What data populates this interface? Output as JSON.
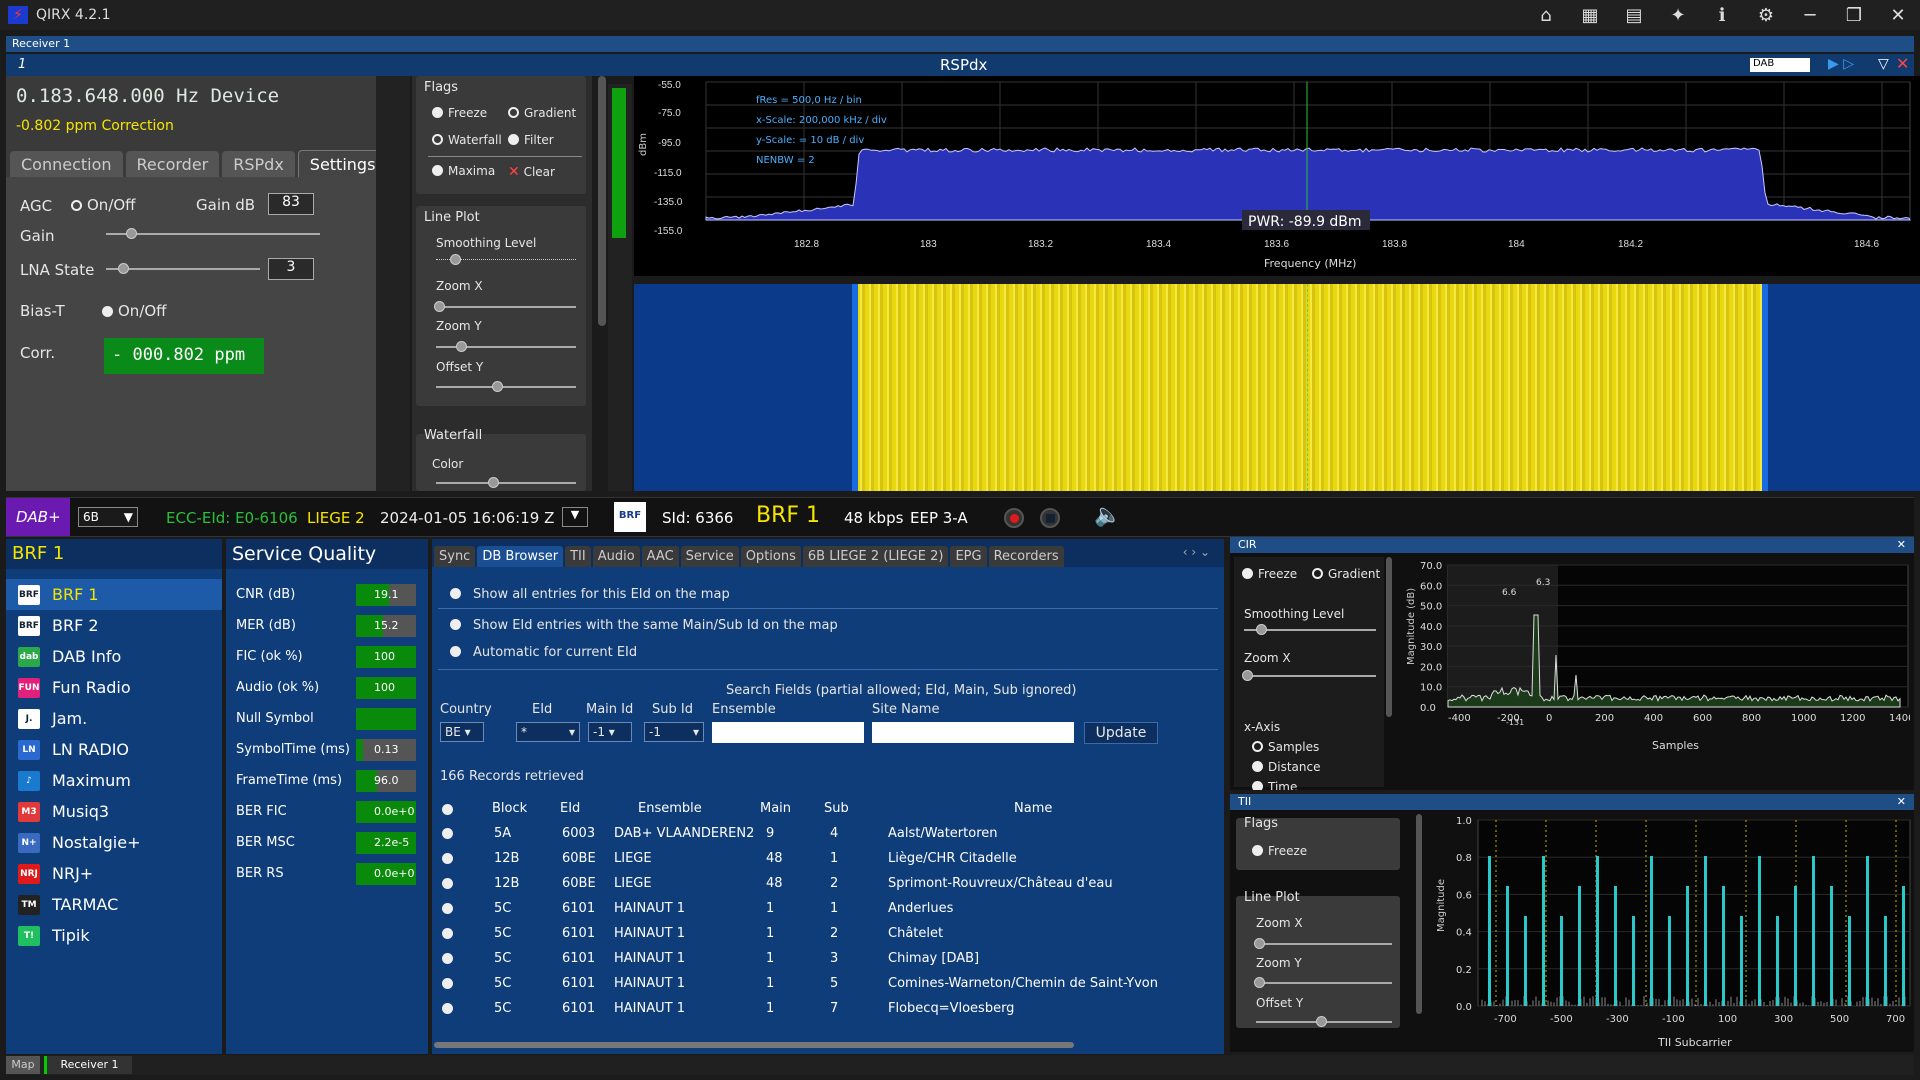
{
  "app": {
    "title": "QIRX 4.2.1",
    "icons": [
      "home-icon",
      "table-icon",
      "map-icon",
      "satellite-icon",
      "info-icon",
      "gear-icon"
    ]
  },
  "receiver": {
    "label": "Receiver 1",
    "number": "1",
    "device": "RSPdx",
    "mode": "DAB"
  },
  "left": {
    "freq": "0.183.648.000 Hz Device",
    "ppm": "-0.802 ppm Correction",
    "tabs": [
      "Connection",
      "Recorder",
      "RSPdx",
      "Settings"
    ],
    "agc": "AGC",
    "agc_toggle": "On/Off",
    "gain_db": "Gain dB",
    "gain_val": "83",
    "gain": "Gain",
    "lna": "LNA State",
    "lna_val": "3",
    "biast": "Bias-T",
    "biast_toggle": "On/Off",
    "corr": "Corr.",
    "corr_val": "- 000.802 ppm"
  },
  "flags": {
    "title": "Flags",
    "freeze": "Freeze",
    "gradient": "Gradient",
    "waterfall": "Waterfall",
    "filter": "Filter",
    "maxima": "Maxima",
    "clear": "Clear",
    "lineplot": "Line Plot",
    "smoothing": "Smoothing Level",
    "zoomx": "Zoom X",
    "zoomy": "Zoom Y",
    "offsety": "Offset Y",
    "wf_title": "Waterfall",
    "color": "Color"
  },
  "spectrum": {
    "ylabel": "dBm",
    "yticks": [
      "-55.0",
      "-75.0",
      "-95.0",
      "-115.0",
      "-135.0",
      "-155.0"
    ],
    "xticks": [
      "182.8",
      "183",
      "183.2",
      "183.4",
      "183.6",
      "183.8",
      "184",
      "184.2",
      "184.6"
    ],
    "xlabel": "Frequency (MHz)",
    "info": [
      "fRes = 500,0 Hz / bin",
      "x-Scale: 200,000 kHz / div",
      "y-Scale: = 10 dB / div",
      "NENBW = 2"
    ],
    "pwr": "PWR: -89.9 dBm"
  },
  "status": {
    "dab": "DAB+",
    "channel": "6B",
    "ecc": "ECC-EId: E0-6106",
    "region": "LIEGE 2",
    "datetime": "2024-01-05  16:06:19 Z",
    "sid": "SId: 6366",
    "service": "BRF 1",
    "rate": "48 kbps",
    "eep": "EEP 3-A"
  },
  "services": {
    "title": "BRF 1",
    "items": [
      {
        "name": "BRF 1",
        "logo": "BRF",
        "color": "#ffffff"
      },
      {
        "name": "BRF 2",
        "logo": "BRF",
        "color": "#ffffff"
      },
      {
        "name": "DAB Info",
        "logo": "dab",
        "color": "#2aa84a"
      },
      {
        "name": "Fun Radio",
        "logo": "FUN",
        "color": "#e0207a"
      },
      {
        "name": "Jam.",
        "logo": "J.",
        "color": "#ffffff"
      },
      {
        "name": "LN RADIO",
        "logo": "LN",
        "color": "#2a6ad0"
      },
      {
        "name": "Maximum",
        "logo": "♪",
        "color": "#1a7ad0"
      },
      {
        "name": "Musiq3",
        "logo": "M3",
        "color": "#e03a3a"
      },
      {
        "name": "Nostalgie+",
        "logo": "N+",
        "color": "#3a6ac0"
      },
      {
        "name": "NRJ+",
        "logo": "NRJ",
        "color": "#e01a1a"
      },
      {
        "name": "TARMAC",
        "logo": "TM",
        "color": "#222"
      },
      {
        "name": "Tipik",
        "logo": "T!",
        "color": "#20c060"
      }
    ]
  },
  "quality": {
    "title": "Service Quality",
    "rows": [
      {
        "label": "CNR (dB)",
        "value": "19.1",
        "fill": 0.55
      },
      {
        "label": "MER (dB)",
        "value": "15.2",
        "fill": 0.45
      },
      {
        "label": "FIC (ok %)",
        "value": "100",
        "fill": 1.0
      },
      {
        "label": "Audio (ok %)",
        "value": "100",
        "fill": 1.0
      },
      {
        "label": "Null Symbol",
        "value": "",
        "fill": 1.0
      },
      {
        "label": "SymbolTime (ms)",
        "value": "0.13",
        "fill": 0.12
      },
      {
        "label": "FrameTime (ms)",
        "value": "96.0",
        "fill": 0.35
      },
      {
        "label": "BER FIC",
        "value": "0.0e+0",
        "fill": 1.0
      },
      {
        "label": "BER MSC",
        "value": "2.2e-5",
        "fill": 1.0
      },
      {
        "label": "BER RS",
        "value": "0.0e+0",
        "fill": 1.0
      }
    ]
  },
  "db": {
    "tabs": [
      "Sync",
      "DB Browser",
      "TII",
      "Audio",
      "AAC",
      "Service",
      "Options",
      "6B LIEGE 2 (LIEGE 2)",
      "EPG",
      "Recorders"
    ],
    "opt1": "Show all entries for this EId on the map",
    "opt2": "Show EId entries with the same Main/Sub Id on the map",
    "opt3": "Automatic for current EId",
    "search": "Search Fields  (partial allowed; EId, Main, Sub ignored)",
    "fields": {
      "country": "Country",
      "eid": "EId",
      "main": "Main Id",
      "sub": "Sub Id",
      "ensemble": "Ensemble",
      "site": "Site Name"
    },
    "vals": {
      "country": "BE",
      "eid": "*",
      "main": "-1",
      "sub": "-1"
    },
    "update": "Update",
    "records": "166 Records retrieved",
    "cols": [
      "Block",
      "EId",
      "Ensemble",
      "Main",
      "Sub",
      "Name"
    ],
    "rows": [
      [
        "5A",
        "6003",
        "DAB+ VLAANDEREN2",
        "9",
        "4",
        "Aalst/Watertoren"
      ],
      [
        "12B",
        "60BE",
        "LIEGE",
        "48",
        "1",
        "Liège/CHR Citadelle"
      ],
      [
        "12B",
        "60BE",
        "LIEGE",
        "48",
        "2",
        "Sprimont-Rouvreux/Château d'eau"
      ],
      [
        "5C",
        "6101",
        "HAINAUT 1",
        "1",
        "1",
        "Anderlues"
      ],
      [
        "5C",
        "6101",
        "HAINAUT 1",
        "1",
        "2",
        "Châtelet"
      ],
      [
        "5C",
        "6101",
        "HAINAUT 1",
        "1",
        "3",
        "Chimay [DAB]"
      ],
      [
        "5C",
        "6101",
        "HAINAUT 1",
        "1",
        "5",
        "Comines-Warneton/Chemin de Saint-Yvon"
      ],
      [
        "5C",
        "6101",
        "HAINAUT 1",
        "1",
        "7",
        "Flobecq=Vloesberg"
      ]
    ]
  },
  "cir": {
    "title": "CIR",
    "freeze": "Freeze",
    "gradient": "Gradient",
    "smoothing": "Smoothing Level",
    "zoomx": "Zoom X",
    "xaxis": "x-Axis",
    "samples": "Samples",
    "distance": "Distance",
    "time": "Time",
    "ylabel": "Magnitude (dB)",
    "yticks": [
      "70.0",
      "60.0",
      "50.0",
      "40.0",
      "30.0",
      "20.0",
      "10.0",
      "0.0"
    ],
    "xticks": [
      "-400",
      "-200",
      "0",
      "200",
      "400",
      "600",
      "800",
      "1000",
      "1200",
      "1400"
    ],
    "xlabel": "Samples",
    "ann1": "6.6",
    "ann2": "6.3",
    "ann3": "-131"
  },
  "tii": {
    "title": "TII",
    "flags": "Flags",
    "freeze": "Freeze",
    "lineplot": "Line Plot",
    "zoomx": "Zoom X",
    "zoomy": "Zoom Y",
    "offsety": "Offset Y",
    "ylabel": "Magnitude",
    "yticks": [
      "1.0",
      "0.8",
      "0.6",
      "0.4",
      "0.2",
      "0.0"
    ],
    "xticks": [
      "-700",
      "-500",
      "-300",
      "-100",
      "100",
      "300",
      "500",
      "700"
    ],
    "xlabel": "TII Subcarrier"
  },
  "bottom": {
    "map": "Map",
    "receiver": "Receiver 1"
  }
}
